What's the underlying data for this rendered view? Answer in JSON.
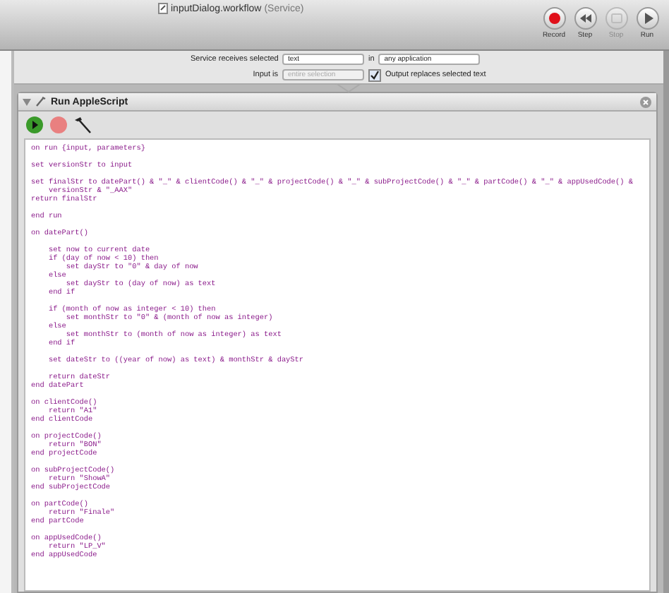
{
  "window": {
    "title": "inputDialog.workflow",
    "subtitle": "(Service)"
  },
  "toolbar": [
    {
      "label": "Record",
      "kind": "record",
      "disabled": false
    },
    {
      "label": "Step",
      "kind": "step",
      "disabled": false
    },
    {
      "label": "Stop",
      "kind": "stop",
      "disabled": true
    },
    {
      "label": "Run",
      "kind": "run",
      "disabled": false
    }
  ],
  "service": {
    "receives_label": "Service receives selected",
    "receives_value": "text",
    "in_label": "in",
    "app_value": "any application",
    "input_label": "Input is",
    "input_value": "entire selection",
    "input_disabled": true,
    "output_replaces": {
      "label": "Output replaces selected text",
      "checked": true
    }
  },
  "action": {
    "title": "Run AppleScript",
    "expanded": true,
    "code_blocks": [
      [
        "on run {input, parameters}"
      ],
      [
        "set versionStr to input"
      ],
      [
        "set finalStr to datePart() & \"_\" & clientCode() & \"_\" & projectCode() & \"_\" & subProjectCode() & \"_\" & partCode() & \"_\" & appUsedCode() &",
        "    versionStr & \"_AAX\"",
        "return finalStr"
      ],
      [
        "end run"
      ],
      [
        "on datePart()"
      ],
      [
        "    set now to current date",
        "    if (day of now < 10) then",
        "        set dayStr to \"0\" & day of now",
        "    else",
        "        set dayStr to (day of now) as text",
        "    end if"
      ],
      [
        "    if (month of now as integer < 10) then",
        "        set monthStr to \"0\" & (month of now as integer)",
        "    else",
        "        set monthStr to (month of now as integer) as text",
        "    end if"
      ],
      [
        "    set dateStr to ((year of now) as text) & monthStr & dayStr"
      ],
      [
        "    return dateStr",
        "end datePart"
      ],
      [
        "on clientCode()",
        "    return \"A1\"",
        "end clientCode"
      ],
      [
        "on projectCode()",
        "    return \"BON\"",
        "end projectCode"
      ],
      [
        "on subProjectCode()",
        "    return \"ShowA\"",
        "end subProjectCode"
      ],
      [
        "on partCode()",
        "    return \"Finale\"",
        "end partCode"
      ],
      [
        "on appUsedCode()",
        "    return \"LP_V\"",
        "end appUsedCode"
      ]
    ]
  }
}
